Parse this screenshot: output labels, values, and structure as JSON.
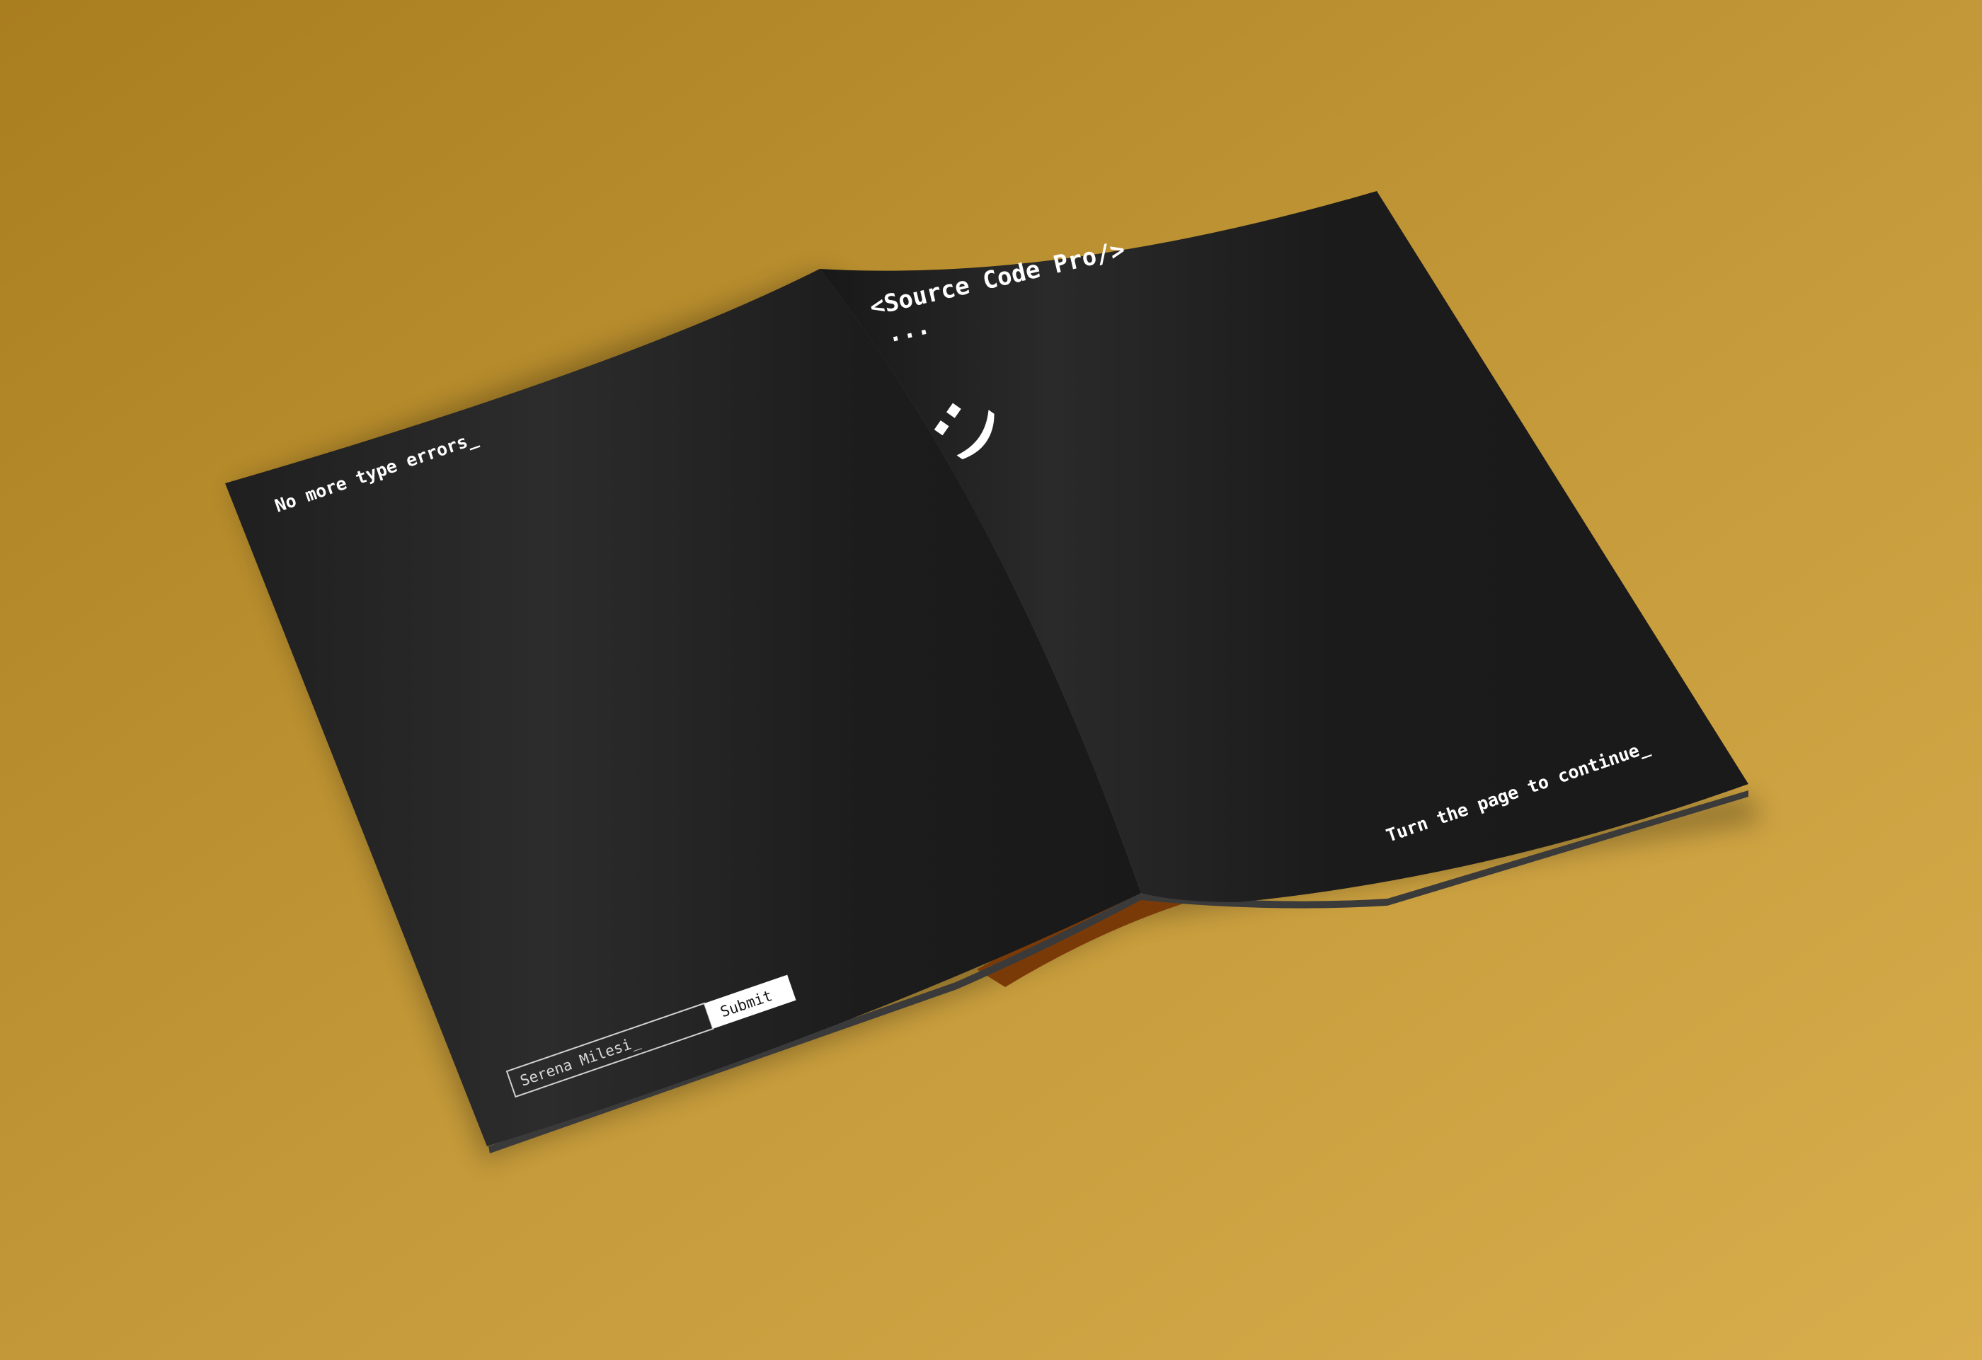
{
  "colors": {
    "background_light": "#d6ab48",
    "background_dark": "#a97e1f",
    "page_dark": "#1b1b1b",
    "page_highlight": "#2e2e2e",
    "text": "#ffffff",
    "accent_underside": "#7a3a08"
  },
  "left_page": {
    "headline": "No more type errors_",
    "name_field": {
      "value": "Serena Milesi_"
    },
    "submit_label": "Submit"
  },
  "right_page": {
    "title": "<Source Code Pro/>",
    "ellipsis": "...",
    "emoticon": ":)",
    "footer": "Turn the page to continue_"
  }
}
